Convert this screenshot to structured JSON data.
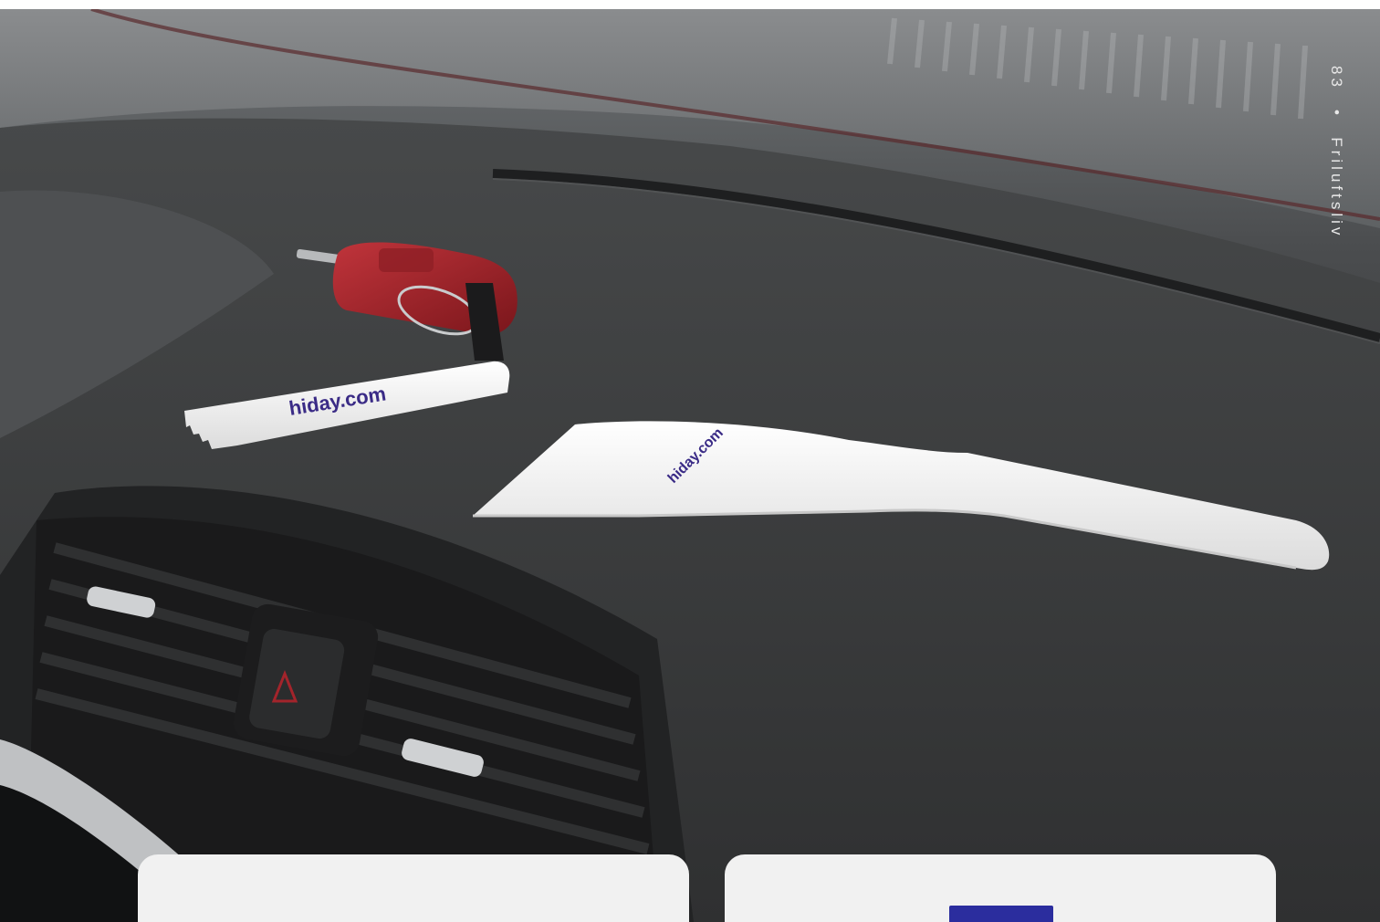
{
  "side_label": {
    "page_number": "83",
    "separator": "•",
    "section": "Friluftsliv"
  },
  "product_photo": {
    "brand_text_tag": "hiday.com",
    "brand_text_scraper": "hiday.com"
  },
  "colors": {
    "dashboard": "#3a3b3c",
    "card_background": "#f1f1f1",
    "swatch": "#2b2d9e",
    "accent_red": "#a3242b"
  }
}
